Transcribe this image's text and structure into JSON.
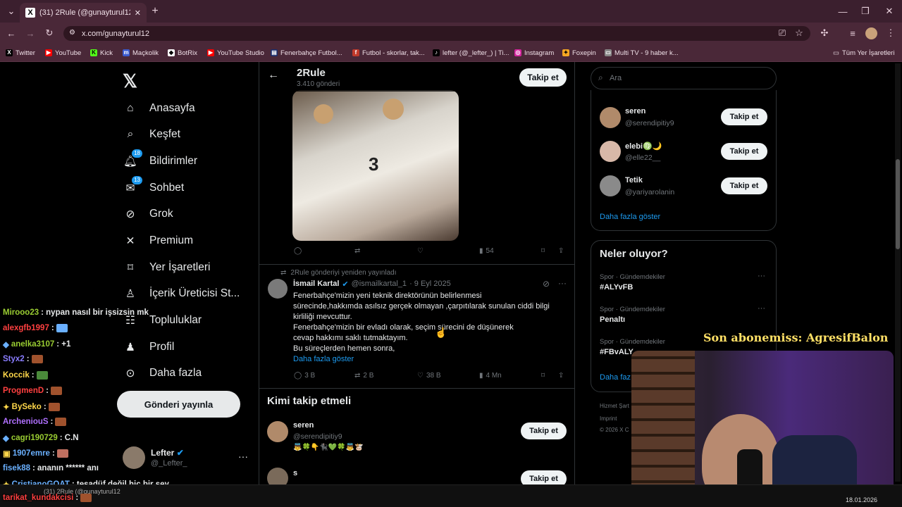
{
  "browser": {
    "tab_title": "(31) 2Rule (@gunayturul12) / X",
    "url": "x.com/gunayturul12",
    "bookmarks": [
      "Twitter",
      "YouTube",
      "Kick",
      "Maçkolik",
      "BotRix",
      "YouTube Studio",
      "Fenerbahçe Futbol...",
      "Futbol - skorlar, tak...",
      "lefter (@_lefter_) | Ti...",
      "Instagram",
      "Foxepin",
      "Multi TV - 9 haber k..."
    ],
    "all_bookmarks": "Tüm Yer İşaretleri",
    "colors": {
      "frame": "#3b1f2e",
      "toolbar": "#4a2838"
    }
  },
  "nav": {
    "items": [
      {
        "label": "Anasayfa",
        "icon": "home-icon"
      },
      {
        "label": "Keşfet",
        "icon": "search-icon"
      },
      {
        "label": "Bildirimler",
        "icon": "bell-icon",
        "badge": "18"
      },
      {
        "label": "Sohbet",
        "icon": "mail-icon",
        "badge": "13"
      },
      {
        "label": "Grok",
        "icon": "grok-icon"
      },
      {
        "label": "Premium",
        "icon": "x-logo-icon"
      },
      {
        "label": "Yer İşaretleri",
        "icon": "bookmark-icon"
      },
      {
        "label": "İçerik Üreticisi St...",
        "icon": "creator-icon"
      },
      {
        "label": "Topluluklar",
        "icon": "communities-icon"
      },
      {
        "label": "Profil",
        "icon": "profile-icon"
      },
      {
        "label": "Daha fazla",
        "icon": "more-circle-icon"
      }
    ],
    "post_button": "Gönderi yayınla",
    "account": {
      "name": "Lefter",
      "handle": "@_Lefter_"
    }
  },
  "profile_header": {
    "name": "2Rule",
    "posts": "3.410 gönderi",
    "follow": "Takip et"
  },
  "post1": {
    "stats": {
      "views": "54"
    }
  },
  "post2": {
    "repost_note": "2Rule gönderiyi yeniden yayınladı",
    "author": "İsmail Kartal",
    "handle": "@ismailkartal_1",
    "date": "· 9 Eyl 2025",
    "lines": [
      "Fenerbahçe'mizin yeni teknik direktörünün belirlenmesi",
      "sürecinde,hakkımda asılsız  gerçek olmayan ,çarpıtılarak sunulan ciddi bilgi",
      "kirliliği mevcuttur.",
      "Fenerbahçe'mizin bir evladı olarak, seçim sürecini de düşünerek",
      "cevap hakkımı saklı tutmaktayım.",
      "Bu süreçlerden hemen sonra,"
    ],
    "show_more": "Daha fazla göster",
    "stats": {
      "replies": "3 B",
      "reposts": "2 B",
      "likes": "38 B",
      "views": "4 Mn"
    }
  },
  "who_to_follow": {
    "title": "Kimi takip etmeli",
    "items": [
      {
        "name": "seren",
        "handle": "@serendipitiy9",
        "bio": "👼🍀👇🐈‍⬛💚🍀👼🐮",
        "button": "Takip et"
      },
      {
        "name": "s",
        "handle": "",
        "button": "Takip et"
      }
    ]
  },
  "right": {
    "search_placeholder": "Ara",
    "suggestions": [
      {
        "name": "seren",
        "handle": "@serendipitiy9",
        "button": "Takip et"
      },
      {
        "name": "elebi♍🌙",
        "handle": "@elle22__",
        "button": "Takip et"
      },
      {
        "name": "Tetik",
        "handle": "@yariyarolanin",
        "button": "Takip et"
      }
    ],
    "show_more": "Daha fazla göster",
    "trends_title": "Neler oluyor?",
    "trends": [
      {
        "context": "Spor · Gündemdekiler",
        "topic": "#ALYvFB"
      },
      {
        "context": "Spor · Gündemdekiler",
        "topic": "Penaltı"
      },
      {
        "context": "Spor · Gündemdekiler",
        "topic": "#FBvALY"
      }
    ],
    "trend_show_more": "Daha faz",
    "footer": [
      "Hizmet Şart",
      "Imprint",
      "© 2026 X C"
    ]
  },
  "overlay": {
    "subscriber": "Son abonemiss: AgresifBalon",
    "chat": [
      {
        "user": "Mirooo23",
        "msg": ": nypan nasıl bir işsizsin mk",
        "color": "#9acd32"
      },
      {
        "user": "alexgfb1997",
        "msg": ":",
        "color": "#ff4040",
        "emote": "#6ab0ff"
      },
      {
        "user": "anelka3107",
        "msg": ": +1",
        "color": "#9acd32"
      },
      {
        "user": "Styx2",
        "msg": ":",
        "color": "#8a7dff",
        "emote": "#a0522d"
      },
      {
        "user": "Koccik",
        "msg": ":",
        "color": "#ffd84a",
        "emote": "#4a8a3a"
      },
      {
        "user": "ProgmenD",
        "msg": ":",
        "color": "#ff4040",
        "emote": "#a0522d"
      },
      {
        "user": "BySeko",
        "msg": ":",
        "color": "#ffd84a",
        "emote": "#a0522d"
      },
      {
        "user": "ArcheniouS",
        "msg": ":",
        "color": "#b070ff",
        "emote": "#a0522d"
      },
      {
        "user": "cagri190729",
        "msg": ": C.N",
        "color": "#9acd32"
      },
      {
        "user": "1907emre",
        "msg": ":",
        "color": "#6ab0ff",
        "emote": "#c07060"
      },
      {
        "user": "fisek88",
        "msg": ": ananın ****** anı",
        "color": "#6ab0ff"
      },
      {
        "user": "CristianoGOAT",
        "msg": ": tesadüf değil hiç bir şey",
        "color": "#6ab0ff"
      },
      {
        "user": "tarikat_kundakcisi",
        "msg": ":",
        "color": "#ff4040",
        "emote": "#a0522d"
      }
    ],
    "taskbar_time": "18.01.2026",
    "taskbar_item": "(31) 2Rule (@gunayturul12"
  }
}
